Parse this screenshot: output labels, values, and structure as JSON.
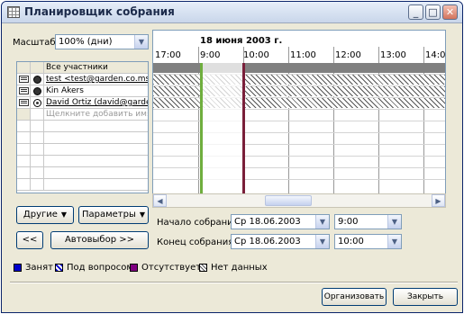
{
  "window": {
    "title": "Планировщик собрания"
  },
  "scale": {
    "label": "Масштаб:",
    "value": "100% (дни)"
  },
  "date_header": "18 июня 2003 г.",
  "times": [
    "17:00",
    "9:00",
    "10:00",
    "11:00",
    "12:00",
    "13:00",
    "14:00"
  ],
  "attendees": {
    "header": "Все участники",
    "rows": [
      {
        "name": "test <test@garden.co.msn.co"
      },
      {
        "name": "Kin Akers"
      },
      {
        "name": "David Ortiz (david@garden"
      }
    ],
    "placeholder": "Щелкните добавить имя"
  },
  "buttons": {
    "others": "Другие",
    "options": "Параметры",
    "prev": "<<",
    "autopick": "Автовыбор >>",
    "organize": "Организовать",
    "close": "Закрыть"
  },
  "meeting": {
    "start_label": "Начало собрания:",
    "start_date": "Ср 18.06.2003",
    "start_time": "9:00",
    "end_label": "Конец собрания:",
    "end_date": "Ср 18.06.2003",
    "end_time": "10:00"
  },
  "legend": [
    {
      "label": "Занят",
      "color": "#0000cc"
    },
    {
      "label": "Под вопросом",
      "color": "#0000cc"
    },
    {
      "label": "Отсутствует",
      "color": "#800080"
    },
    {
      "label": "Нет данных",
      "color": "#ffffff"
    }
  ]
}
